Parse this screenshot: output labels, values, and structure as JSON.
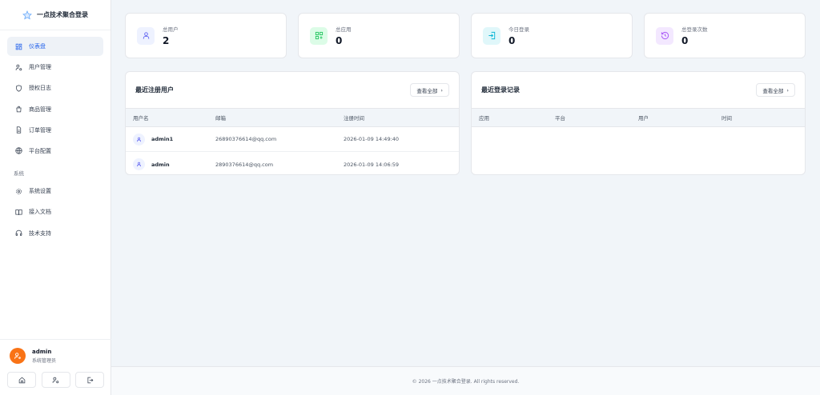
{
  "app": {
    "title": "一点技术聚合登录"
  },
  "sidebar": {
    "items": [
      {
        "label": "仪表盘",
        "icon": "dashboard-icon"
      },
      {
        "label": "用户管理",
        "icon": "user-manage-icon"
      },
      {
        "label": "授权日志",
        "icon": "shield-icon"
      },
      {
        "label": "商品管理",
        "icon": "shopping-bag-icon"
      },
      {
        "label": "订单管理",
        "icon": "document-icon"
      },
      {
        "label": "平台配置",
        "icon": "globe-icon"
      }
    ],
    "section": "系统",
    "system_items": [
      {
        "label": "系统设置",
        "icon": "gear-icon"
      },
      {
        "label": "接入文档",
        "icon": "book-icon"
      },
      {
        "label": "技术支持",
        "icon": "headset-icon"
      }
    ]
  },
  "user": {
    "name": "admin",
    "role": "系统管理员"
  },
  "stats": [
    {
      "label": "总用户",
      "value": "2",
      "icon": "user-icon",
      "color": "#6366f1",
      "bg": "#eef2ff"
    },
    {
      "label": "总应用",
      "value": "0",
      "icon": "apps-icon",
      "color": "#22c55e",
      "bg": "#dcfce7"
    },
    {
      "label": "今日登录",
      "value": "0",
      "icon": "login-icon",
      "color": "#06b6d4",
      "bg": "#e0f7fa"
    },
    {
      "label": "总登录次数",
      "value": "0",
      "icon": "history-icon",
      "color": "#a855f7",
      "bg": "#f3e8ff"
    }
  ],
  "recent_users": {
    "title": "最近注册用户",
    "view_all": "查看全部",
    "columns": [
      "用户名",
      "邮箱",
      "注册时间"
    ],
    "rows": [
      {
        "username": "admin1",
        "email": "26890376614@qq.com",
        "time": "2026-01-09 14:49:40"
      },
      {
        "username": "admin",
        "email": "2890376614@qq.com",
        "time": "2026-01-09 14:06:59"
      }
    ]
  },
  "recent_logins": {
    "title": "最近登录记录",
    "view_all": "查看全部",
    "columns": [
      "应用",
      "平台",
      "用户",
      "时间"
    ]
  },
  "footer": {
    "text": "© 2026 一点技术聚合登录. All rights reserved."
  }
}
